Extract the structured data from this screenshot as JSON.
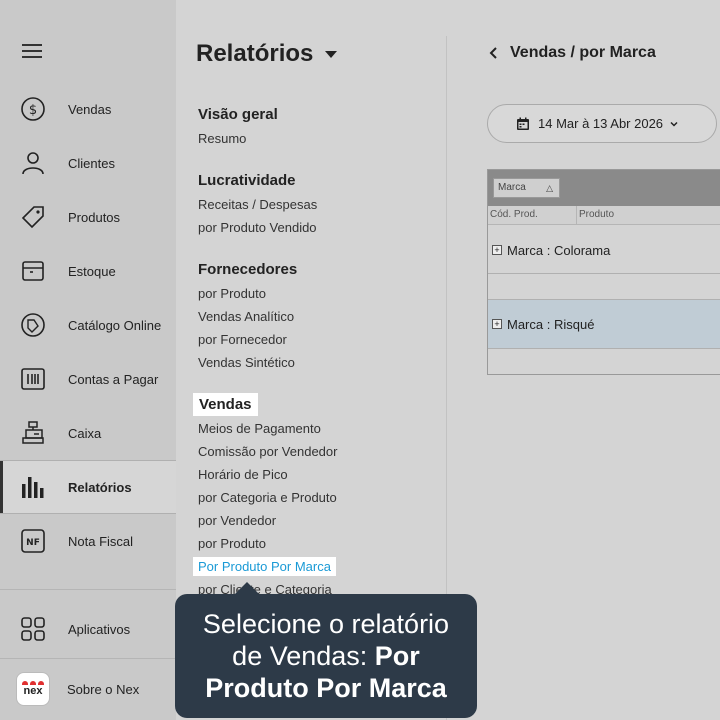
{
  "sidebar": {
    "items": [
      {
        "label": "Vendas",
        "icon": "dollar-circle-icon"
      },
      {
        "label": "Clientes",
        "icon": "user-icon"
      },
      {
        "label": "Produtos",
        "icon": "tag-icon"
      },
      {
        "label": "Estoque",
        "icon": "box-icon"
      },
      {
        "label": "Catálogo Online",
        "icon": "catalog-icon"
      },
      {
        "label": "Contas a Pagar",
        "icon": "barcode-icon"
      },
      {
        "label": "Caixa",
        "icon": "register-icon"
      },
      {
        "label": "Relatórios",
        "icon": "bar-chart-icon"
      },
      {
        "label": "Nota Fiscal",
        "icon": "nf-icon",
        "badge": "NF"
      }
    ],
    "apps_label": "Aplicativos",
    "about_label": "Sobre o Nex",
    "logo_text": "nex"
  },
  "menu": {
    "title": "Relatórios",
    "sections": [
      {
        "heading": "Visão geral",
        "items": [
          "Resumo"
        ]
      },
      {
        "heading": "Lucratividade",
        "items": [
          "Receitas / Despesas",
          "por Produto Vendido"
        ]
      },
      {
        "heading": "Fornecedores",
        "items": [
          "por Produto",
          "Vendas Analítico",
          "por Fornecedor",
          "Vendas Sintético"
        ]
      },
      {
        "heading": "Vendas",
        "items": [
          "Meios de Pagamento",
          "Comissão por Vendedor",
          "Horário de Pico",
          "por Categoria e Produto",
          "por Vendedor",
          "por Produto",
          "Por Produto Por Marca",
          "por Cliente e Categoria"
        ]
      }
    ]
  },
  "content": {
    "breadcrumb": "Vendas / por Marca",
    "date_range": "14 Mar  à  13 Abr 2026",
    "grid": {
      "group_chip": "Marca",
      "columns": [
        "Cód. Prod.",
        "Produto"
      ],
      "groups": [
        "Marca : Colorama",
        "Marca : Risqué"
      ]
    }
  },
  "tooltip": {
    "line1": "Selecione o relatório",
    "line2_plain": "de Vendas: ",
    "line2_bold": "Por",
    "line3_bold": "Produto Por Marca"
  },
  "colors": {
    "accent": "#1a9ad6",
    "tooltip_bg": "#2d3a48",
    "highlight_row": "#c0ccd5"
  }
}
